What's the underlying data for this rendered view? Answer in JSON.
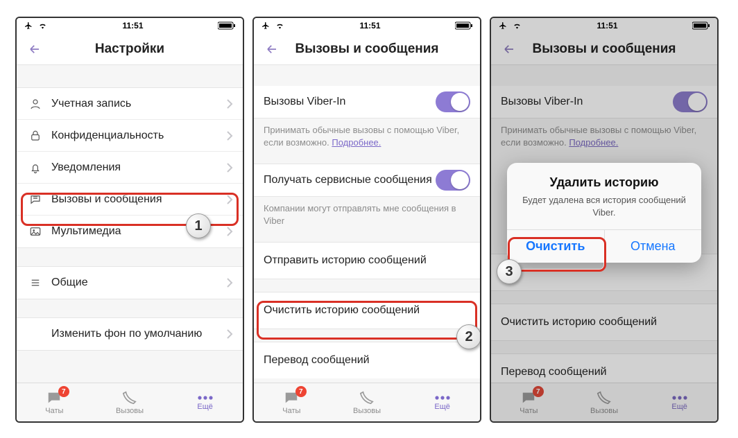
{
  "status": {
    "time": "11:51"
  },
  "screen1": {
    "title": "Настройки",
    "items": {
      "account": "Учетная запись",
      "privacy": "Конфиденциальность",
      "notifications": "Уведомления",
      "calls_messages": "Вызовы и сообщения",
      "media": "Мультимедиа",
      "general": "Общие",
      "wallpaper": "Изменить фон по умолчанию"
    }
  },
  "screen2": {
    "title": "Вызовы и сообщения",
    "viber_in_label": "Вызовы Viber-In",
    "viber_in_note_prefix": "Принимать обычные вызовы с помощью Viber, если возможно. ",
    "viber_in_note_link": "Подробнее.",
    "service_msgs_label": "Получать сервисные сообщения",
    "service_msgs_note": "Компании могут отправлять мне сообщения в Viber",
    "send_history": "Отправить историю сообщений",
    "clear_history": "Очистить историю сообщений",
    "translate": "Перевод сообщений"
  },
  "screen3": {
    "title": "Вызовы и сообщения",
    "dialog": {
      "title": "Удалить историю",
      "message": "Будет удалена вся история сообщений Viber.",
      "confirm": "Очистить",
      "cancel": "Отмена"
    }
  },
  "tabs": {
    "chats": "Чаты",
    "calls": "Вызовы",
    "more": "Ещё",
    "badge": "7"
  },
  "steps": {
    "s1": "1",
    "s2": "2",
    "s3": "3"
  }
}
